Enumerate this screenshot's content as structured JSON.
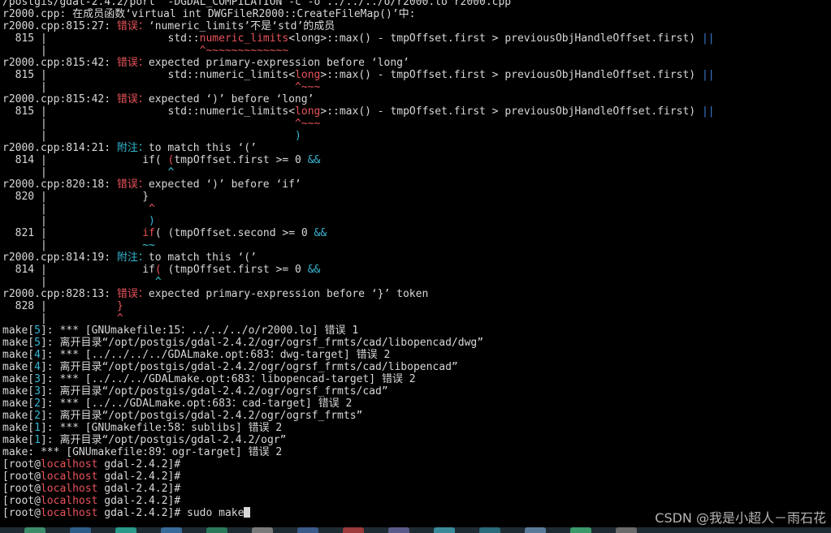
{
  "colors": {
    "background": "#000000",
    "text": "#d8d8d8",
    "error": "#e8535a",
    "note": "#35b8d4",
    "pipe": "#3a7bd5",
    "taskbar": "#1f2b33"
  },
  "terminal": {
    "lines": [
      [
        {
          "t": "/postgis/gdal-2.4.2/port  -DGDAL_COMPILATION -c -o ../../../o/r2000.lo r2000.cpp"
        }
      ],
      [
        {
          "t": "r2000.cpp: 在成员函数‘virtual int DWGFileR2000::CreateFileMap()’中:"
        }
      ],
      [
        {
          "t": "r2000.cpp:815:27: "
        },
        {
          "t": "错误：",
          "c": "err"
        },
        {
          "t": "‘numeric_limits’不是‘std’的成员"
        }
      ],
      [
        {
          "t": "  815 | ",
          "c": "gutter"
        },
        {
          "t": "                  std::"
        },
        {
          "t": "numeric_limits",
          "c": "kw"
        },
        {
          "t": "<long>::max() - tmpOffset.first > previousObjHandleOffset.first) "
        },
        {
          "t": "||",
          "c": "pipe"
        }
      ],
      [
        {
          "t": "      | ",
          "c": "gutter"
        },
        {
          "t": "                       "
        },
        {
          "t": "^~~~~~~~~~~~~~",
          "c": "caret"
        }
      ],
      [
        {
          "t": "r2000.cpp:815:42: "
        },
        {
          "t": "错误：",
          "c": "err"
        },
        {
          "t": "expected primary-expression before ‘long’"
        }
      ],
      [
        {
          "t": "  815 | ",
          "c": "gutter"
        },
        {
          "t": "                  std::numeric_limits<"
        },
        {
          "t": "long",
          "c": "kw"
        },
        {
          "t": ">::max() - tmpOffset.first > previousObjHandleOffset.first) "
        },
        {
          "t": "||",
          "c": "pipe"
        }
      ],
      [
        {
          "t": "      | ",
          "c": "gutter"
        },
        {
          "t": "                                      "
        },
        {
          "t": "^~~~",
          "c": "caret"
        }
      ],
      [
        {
          "t": "r2000.cpp:815:42: "
        },
        {
          "t": "错误：",
          "c": "err"
        },
        {
          "t": "expected ‘)’ before ‘long’"
        }
      ],
      [
        {
          "t": "  815 | ",
          "c": "gutter"
        },
        {
          "t": "                  std::numeric_limits<"
        },
        {
          "t": "long",
          "c": "kw"
        },
        {
          "t": ">::max() - tmpOffset.first > previousObjHandleOffset.first) "
        },
        {
          "t": "||",
          "c": "pipe"
        }
      ],
      [
        {
          "t": "      | ",
          "c": "gutter"
        },
        {
          "t": "                                      "
        },
        {
          "t": "^~~~",
          "c": "caret"
        }
      ],
      [
        {
          "t": "      | ",
          "c": "gutter"
        },
        {
          "t": "                                      "
        },
        {
          "t": ")",
          "c": "note"
        }
      ],
      [
        {
          "t": "r2000.cpp:814:21: "
        },
        {
          "t": "附注：",
          "c": "note"
        },
        {
          "t": "to match this ‘(’"
        }
      ],
      [
        {
          "t": "  814 | ",
          "c": "gutter"
        },
        {
          "t": "              if( "
        },
        {
          "t": "(",
          "c": "kw"
        },
        {
          "t": "tmpOffset.first >= 0 "
        },
        {
          "t": "&&",
          "c": "amp"
        }
      ],
      [
        {
          "t": "      | ",
          "c": "gutter"
        },
        {
          "t": "                  "
        },
        {
          "t": "^",
          "c": "ncaret"
        }
      ],
      [
        {
          "t": "r2000.cpp:820:18: "
        },
        {
          "t": "错误：",
          "c": "err"
        },
        {
          "t": "expected ‘)’ before ‘if’"
        }
      ],
      [
        {
          "t": "  820 | ",
          "c": "gutter"
        },
        {
          "t": "              }"
        }
      ],
      [
        {
          "t": "      | ",
          "c": "gutter"
        },
        {
          "t": "               "
        },
        {
          "t": "^",
          "c": "caret"
        }
      ],
      [
        {
          "t": "      | ",
          "c": "gutter"
        },
        {
          "t": "               "
        },
        {
          "t": ")",
          "c": "note"
        }
      ],
      [
        {
          "t": "  821 | ",
          "c": "gutter"
        },
        {
          "t": "              "
        },
        {
          "t": "if",
          "c": "kw"
        },
        {
          "t": "( (tmpOffset.second >= 0 "
        },
        {
          "t": "&&",
          "c": "amp"
        }
      ],
      [
        {
          "t": "      | ",
          "c": "gutter"
        },
        {
          "t": "              "
        },
        {
          "t": "~~",
          "c": "ncaret"
        }
      ],
      [
        {
          "t": "r2000.cpp:814:19: "
        },
        {
          "t": "附注：",
          "c": "note"
        },
        {
          "t": "to match this ‘(’"
        }
      ],
      [
        {
          "t": "  814 | ",
          "c": "gutter"
        },
        {
          "t": "              if"
        },
        {
          "t": "(",
          "c": "kw"
        },
        {
          "t": " (tmpOffset.first >= 0 "
        },
        {
          "t": "&&",
          "c": "amp"
        }
      ],
      [
        {
          "t": "      | ",
          "c": "gutter"
        },
        {
          "t": "                "
        },
        {
          "t": "^",
          "c": "ncaret"
        }
      ],
      [
        {
          "t": "r2000.cpp:828:13: "
        },
        {
          "t": "错误：",
          "c": "err"
        },
        {
          "t": "expected primary-expression before ‘}’ token"
        }
      ],
      [
        {
          "t": "  828 | ",
          "c": "gutter"
        },
        {
          "t": "          "
        },
        {
          "t": "}",
          "c": "kw"
        }
      ],
      [
        {
          "t": "      | ",
          "c": "gutter"
        },
        {
          "t": "          "
        },
        {
          "t": "^",
          "c": "caret"
        }
      ],
      [
        {
          "t": "make["
        },
        {
          "t": "5",
          "c": "make-n"
        },
        {
          "t": "]: *** [GNUmakefile:15：../../../o/r2000.lo] 错误 1"
        }
      ],
      [
        {
          "t": "make["
        },
        {
          "t": "5",
          "c": "make-n"
        },
        {
          "t": "]: 离开目录“/opt/postgis/gdal-2.4.2/ogr/ogrsf_frmts/cad/libopencad/dwg”"
        }
      ],
      [
        {
          "t": "make["
        },
        {
          "t": "4",
          "c": "make-n"
        },
        {
          "t": "]: *** [../../../../GDALmake.opt:683：dwg-target] 错误 2"
        }
      ],
      [
        {
          "t": "make["
        },
        {
          "t": "4",
          "c": "make-n"
        },
        {
          "t": "]: 离开目录“/opt/postgis/gdal-2.4.2/ogr/ogrsf_frmts/cad/libopencad”"
        }
      ],
      [
        {
          "t": "make["
        },
        {
          "t": "3",
          "c": "make-n"
        },
        {
          "t": "]: *** [../../../GDALmake.opt:683：libopencad-target] 错误 2"
        }
      ],
      [
        {
          "t": "make["
        },
        {
          "t": "3",
          "c": "make-n"
        },
        {
          "t": "]: 离开目录“/opt/postgis/gdal-2.4.2/ogr/ogrsf_frmts/cad”"
        }
      ],
      [
        {
          "t": "make["
        },
        {
          "t": "2",
          "c": "make-n"
        },
        {
          "t": "]: *** [../../GDALmake.opt:683：cad-target] 错误 2"
        }
      ],
      [
        {
          "t": "make["
        },
        {
          "t": "2",
          "c": "make-n"
        },
        {
          "t": "]: 离开目录“/opt/postgis/gdal-2.4.2/ogr/ogrsf_frmts”"
        }
      ],
      [
        {
          "t": "make["
        },
        {
          "t": "1",
          "c": "make-n"
        },
        {
          "t": "]: *** [GNUmakefile:58：sublibs] 错误 2"
        }
      ],
      [
        {
          "t": "make["
        },
        {
          "t": "1",
          "c": "make-n"
        },
        {
          "t": "]: 离开目录“/opt/postgis/gdal-2.4.2/ogr”"
        }
      ],
      [
        {
          "t": "make: *** [GNUmakefile:89：ogr-target] 错误 2"
        }
      ],
      [
        {
          "t": "[root@"
        },
        {
          "t": "localhost",
          "c": "host"
        },
        {
          "t": " gdal-2.4.2]#"
        }
      ],
      [
        {
          "t": "[root@"
        },
        {
          "t": "localhost",
          "c": "host"
        },
        {
          "t": " gdal-2.4.2]#"
        }
      ],
      [
        {
          "t": "[root@"
        },
        {
          "t": "localhost",
          "c": "host"
        },
        {
          "t": " gdal-2.4.2]#"
        }
      ],
      [
        {
          "t": "[root@"
        },
        {
          "t": "localhost",
          "c": "host"
        },
        {
          "t": " gdal-2.4.2]#"
        }
      ]
    ],
    "prompt": {
      "user": "[root@",
      "host": "localhost",
      "path": " gdal-2.4.2]# ",
      "command": "sudo make"
    }
  },
  "watermark": "CSDN @我是小超人－雨石花",
  "taskbar_icons": [
    "app-icon",
    "app-icon",
    "app-icon",
    "app-icon",
    "app-icon",
    "app-icon",
    "app-icon",
    "app-icon",
    "app-icon",
    "app-icon",
    "app-icon",
    "app-icon",
    "app-icon",
    "app-icon"
  ]
}
